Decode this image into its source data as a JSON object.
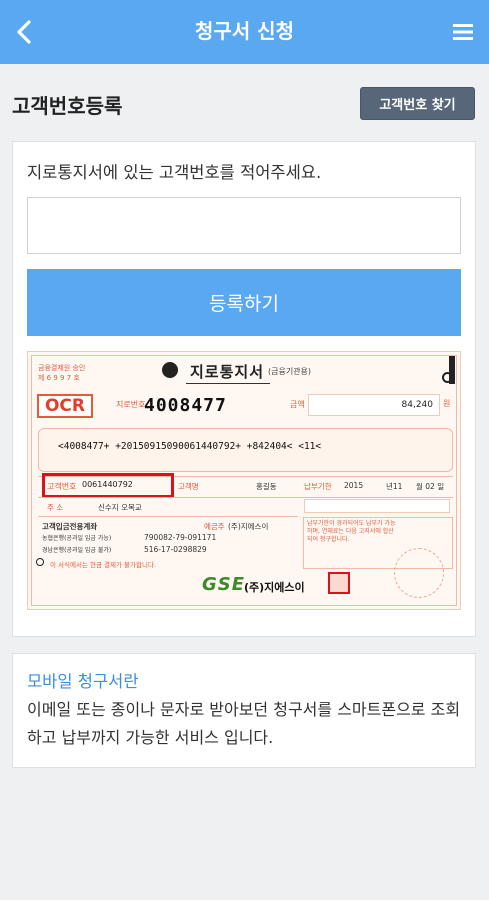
{
  "header": {
    "title": "청구서 신청"
  },
  "section": {
    "title": "고객번호등록",
    "find_button": "고객번호 찾기"
  },
  "form": {
    "instruction": "지로통지서에 있는 고객번호를 적어주세요.",
    "input_value": "",
    "input_placeholder": "",
    "register_button": "등록하기"
  },
  "slip": {
    "title": "지로통지서",
    "subtitle": "(금융기관용)",
    "ocr_label": "OCR",
    "giro_number_label": "지로번호",
    "giro_number": "4008477",
    "amount_label": "금액",
    "amount": "84,240",
    "amount_unit": "원",
    "ocr_line": "<4008477+ +20150915090061440792+   +842404< <11<",
    "customer_number_label": "고객번호",
    "customer_number": "0061440792",
    "customer_name_label": "고객명",
    "customer_name": "홍길동",
    "due_label": "납부기한",
    "due_year": "2015",
    "due_month_label": "년11",
    "due_day_label": "월 02 일",
    "address_label": "주 소",
    "address": "신수지 오목교",
    "account_header": "고객입금전용계좌",
    "account_holder_label": "예금주",
    "account_holder": "(주)지에스이",
    "account_row1_label": "농협은행(공과일 입금 가능)",
    "account_row1": "790082-79-091171",
    "account_row2_label": "경남은행(공과일 입금 불가)",
    "account_row2": "516-17-0298829",
    "note": "이 서식에서는 현금 결제가 불가합니다.",
    "brand": "GSE",
    "brand_sub": "(주)지에스이",
    "top_left_note1": "금융결제원 승인",
    "top_left_note2": "제 6 9 9 7 호",
    "right_notes": "납부기한이 경과되어도 납부가 가능하며, 연체료는 다음 고지서에 합산되어 청구합니다."
  },
  "info": {
    "heading": "모바일 청구서란",
    "body": "이메일 또는 종이나 문자로 받아보던 청구서를 스마트폰으로 조회하고 납부까지 가능한 서비스 입니다."
  },
  "colors": {
    "accent": "#5aa8f0",
    "find_button_bg": "#58667a",
    "link": "#3a8ee6",
    "highlight": "#d8131b"
  },
  "icons": {
    "back": "chevron-left-icon",
    "menu": "hamburger-menu-icon"
  }
}
